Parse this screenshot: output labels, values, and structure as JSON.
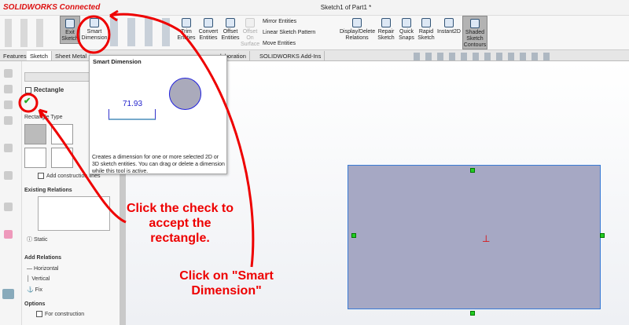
{
  "app": {
    "logo": "SOLIDWORKS Connected",
    "document_title": "Sketch1 of Part1 *"
  },
  "ribbon": {
    "exit_sketch": "Exit Sketch",
    "smart_dimension": "Smart Dimension",
    "trim_entities": "Trim Entities",
    "convert_entities": "Convert Entities",
    "offset_entities": "Offset Entities",
    "offset_on_surface": "Offset On Surface",
    "mirror_entities": "Mirror Entities",
    "linear_sketch_pattern": "Linear Sketch Pattern",
    "move_entities": "Move Entities",
    "display_delete_relations": "Display/Delete Relations",
    "repair_sketch": "Repair Sketch",
    "quick_snaps": "Quick Snaps",
    "rapid_sketch": "Rapid Sketch",
    "instant2d": "Instant2D",
    "shaded_sketch_contours": "Shaded Sketch Contours"
  },
  "tabs": [
    "Features",
    "Sketch",
    "Sheet Metal",
    "laboration",
    "SOLIDWORKS Add-Ins"
  ],
  "property_manager": {
    "title": "Rectangle",
    "rectangle_type": "Rectangle Type",
    "add_construction_lines": "Add construction lines",
    "existing_relations": "Existing Relations",
    "static": "Static",
    "add_relations": "Add Relations",
    "relations": [
      "Horizontal",
      "Vertical",
      "Fix"
    ],
    "options": "Options",
    "for_construction": "For construction"
  },
  "tooltip": {
    "title": "Smart Dimension",
    "dimension_value": "71.93",
    "description": "Creates a dimension for one or more selected 2D or 3D sketch entities. You can drag or delete a dimension while this tool is active."
  },
  "annotations": {
    "check_note": "Click the check to accept the rectangle.",
    "smart_dim_note": "Click on \"Smart Dimension\""
  },
  "colors": {
    "annotation": "#e00000",
    "rectangle_fill": "#a6a8c4",
    "selection": "#3a7bd5"
  }
}
